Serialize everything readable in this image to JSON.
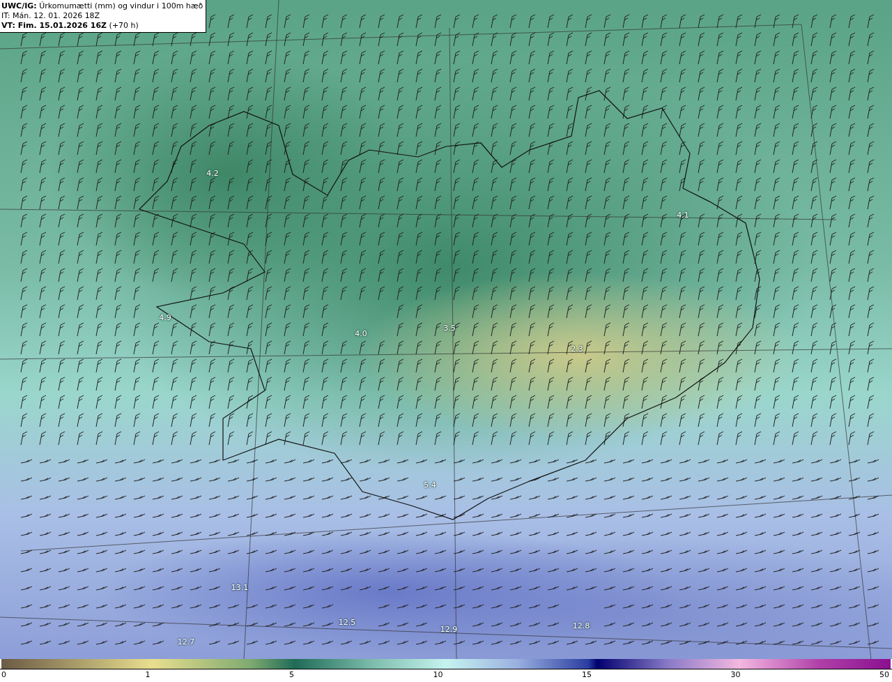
{
  "title_box": {
    "lines": [
      "**UWC/IG:** Úrkomumætti (mm) og vindur i 100m hæð",
      "IT: Mán. 12. 01. 2026 18Z",
      "**VT: Fim. 15.01.2026 16Z** (+70 h)"
    ]
  },
  "map": {
    "value_labels": [
      "4.2",
      "4.1",
      "4.9",
      "4.0",
      "3.5",
      "2.3",
      "5.4",
      "13.1",
      "12.5",
      "12.9",
      "12.8",
      "12.7"
    ]
  },
  "colorbar": {
    "ticks": [
      "0",
      "1",
      "5",
      "10",
      "15",
      "30",
      "50"
    ]
  }
}
